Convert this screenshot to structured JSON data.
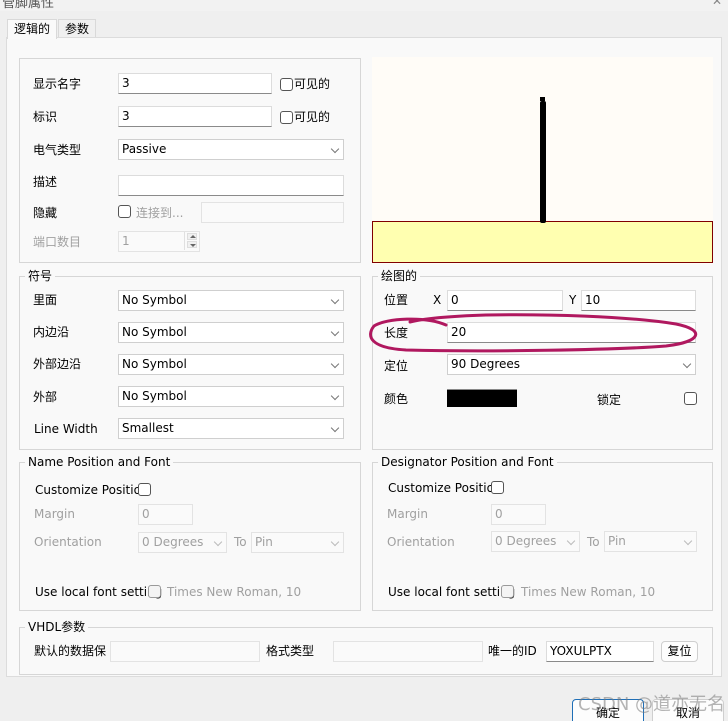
{
  "window": {
    "title": "管脚属性",
    "close_icon": "close-icon"
  },
  "tabs": [
    {
      "label": "逻辑的",
      "active": true
    },
    {
      "label": "参数",
      "active": false
    }
  ],
  "logical": {
    "display_name": {
      "label": "显示名字",
      "value": "3",
      "visible_label": "可见的",
      "visible": false
    },
    "designator": {
      "label": "标识",
      "value": "3",
      "visible_label": "可见的",
      "visible": false
    },
    "electrical_type": {
      "label": "电气类型",
      "value": "Passive"
    },
    "description": {
      "label": "描述",
      "value": ""
    },
    "hide": {
      "label": "隐藏",
      "checked": false,
      "connect_label": "连接到...",
      "connect_value": ""
    },
    "port_count": {
      "label": "端口数目",
      "value": "1"
    }
  },
  "preview": {
    "background": "#fffcf7",
    "body_fill": "#ffffb0",
    "body_border": "#800000",
    "pin_color": "#000000"
  },
  "symbols": {
    "title": "符号",
    "rows": [
      {
        "label": "里面",
        "value": "No Symbol"
      },
      {
        "label": "内边沿",
        "value": "No Symbol"
      },
      {
        "label": "外部边沿",
        "value": "No Symbol"
      },
      {
        "label": "外部",
        "value": "No Symbol"
      },
      {
        "label": "Line Width",
        "value": "Smallest"
      }
    ]
  },
  "graphical": {
    "title": "绘图的",
    "position": {
      "label": "位置",
      "x_label": "X",
      "x": "0",
      "y_label": "Y",
      "y": "10"
    },
    "length": {
      "label": "长度",
      "value": "20"
    },
    "orientation": {
      "label": "定位",
      "value": "90 Degrees"
    },
    "color": {
      "label": "颜色",
      "value": "#000000"
    },
    "locked": {
      "label": "锁定",
      "checked": false
    },
    "annotation_color": "#b0185f"
  },
  "name_font": {
    "title": "Name Position and Font",
    "customize_label": "Customize Position",
    "margin_label": "Margin",
    "margin": "0",
    "orientation_label": "Orientation",
    "orientation": "0 Degrees",
    "to_label": "To",
    "to": "Pin",
    "local_font_label": "Use local font setting",
    "font": "Times New Roman, 10"
  },
  "designator_font": {
    "title": "Designator Position and Font",
    "customize_label": "Customize Position",
    "margin_label": "Margin",
    "margin": "0",
    "orientation_label": "Orientation",
    "orientation": "0 Degrees",
    "to_label": "To",
    "to": "Pin",
    "local_font_label": "Use local font setting",
    "font": "Times New Roman, 10"
  },
  "vhdl": {
    "title": "VHDL参数",
    "default_label": "默认的数据保",
    "default_value": "",
    "format_label": "格式类型",
    "format_value": "",
    "uid_label": "唯一的ID",
    "uid_value": "YOXULPTX",
    "reset_label": "复位"
  },
  "footer": {
    "ok_label": "确定",
    "cancel_label": "取消",
    "watermark": "CSDN @道亦无名"
  }
}
